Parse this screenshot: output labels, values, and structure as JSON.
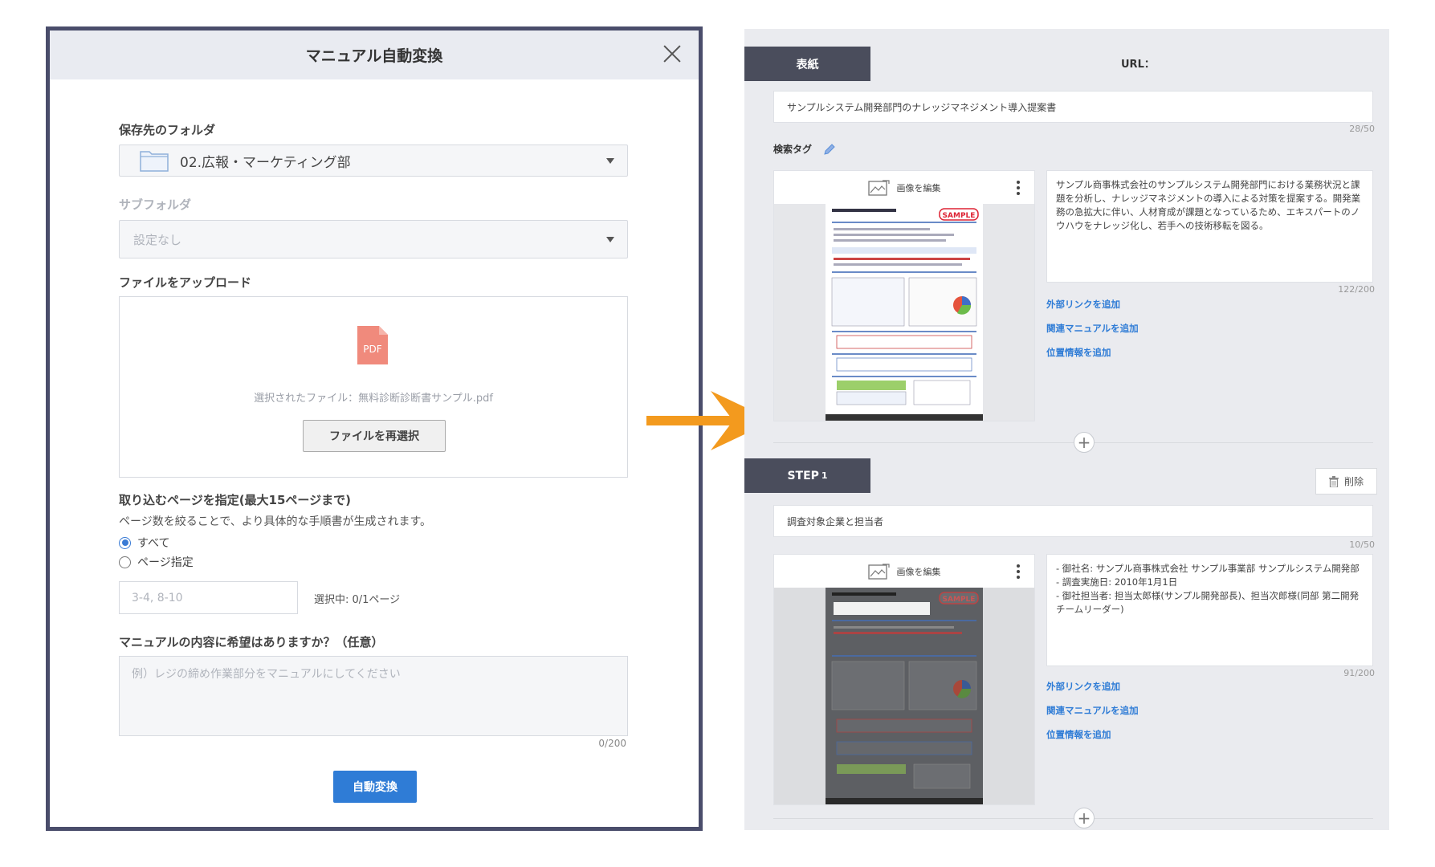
{
  "dialog": {
    "title": "マニュアル自動変換",
    "folder_label": "保存先のフォルダ",
    "folder_value": "02.広報・マーケティング部",
    "subfolder_label": "サブフォルダ",
    "subfolder_value": "設定なし",
    "upload_label": "ファイルをアップロード",
    "selected_file_text": "選択されたファイル：無料診断診断書サンプル.pdf",
    "reselect_label": "ファイルを再選択",
    "pages_label": "取り込むページを指定(最大15ページまで)",
    "pages_hint": "ページ数を絞ることで、より具体的な手順書が生成されます。",
    "radio_all": "すべて",
    "radio_pages": "ページ指定",
    "pages_placeholder": "3-4, 8-10",
    "selected_count": "選択中: 0/1ページ",
    "request_label": "マニュアルの内容に希望はありますか？（任意）",
    "request_placeholder": "例）レジの締め作業部分をマニュアルにしてください",
    "request_counter": "0/200",
    "convert_label": "自動変換"
  },
  "editor": {
    "cover_tab": "表紙",
    "url_label": "URL：",
    "cover_title": "サンプルシステム開発部門のナレッジマネジメント導入提案書",
    "cover_title_count": "28/50",
    "tag_label": "検索タグ",
    "edit_image_label": "画像を編集",
    "cover_desc": "サンプル商事株式会社のサンプルシステム開発部門における業務状況と課題を分析し、ナレッジマネジメントの導入による対策を提案する。開発業務の急拡大に伴い、人材育成が課題となっているため、エキスパートのノウハウをナレッジ化し、若手への技術移転を図る。",
    "cover_desc_count": "122/200",
    "links": [
      "外部リンクを追加",
      "関連マニュアルを追加",
      "位置情報を追加"
    ],
    "step_tab": "STEP",
    "step_number": "1",
    "delete_label": "削除",
    "step_title": "調査対象企業と担当者",
    "step_title_count": "10/50",
    "step_desc": "- 御社名: サンプル商事株式会社 サンプル事業部 サンプルシステム開発部\n- 調査実施日: 2010年1月1日\n- 御社担当者: 担当太郎様(サンプル開発部長)、担当次郎様(同部 第二開発チームリーダー)",
    "step_desc_count": "91/200",
    "sample_stamp": "SAMPLE",
    "plus": "+"
  },
  "colors": {
    "accent": "#2f7cd6",
    "dialog_border": "#4a4d6b",
    "tab_bg": "#4a4d5c",
    "arrow": "#f39a1e",
    "pdf": "#f08a7c"
  }
}
